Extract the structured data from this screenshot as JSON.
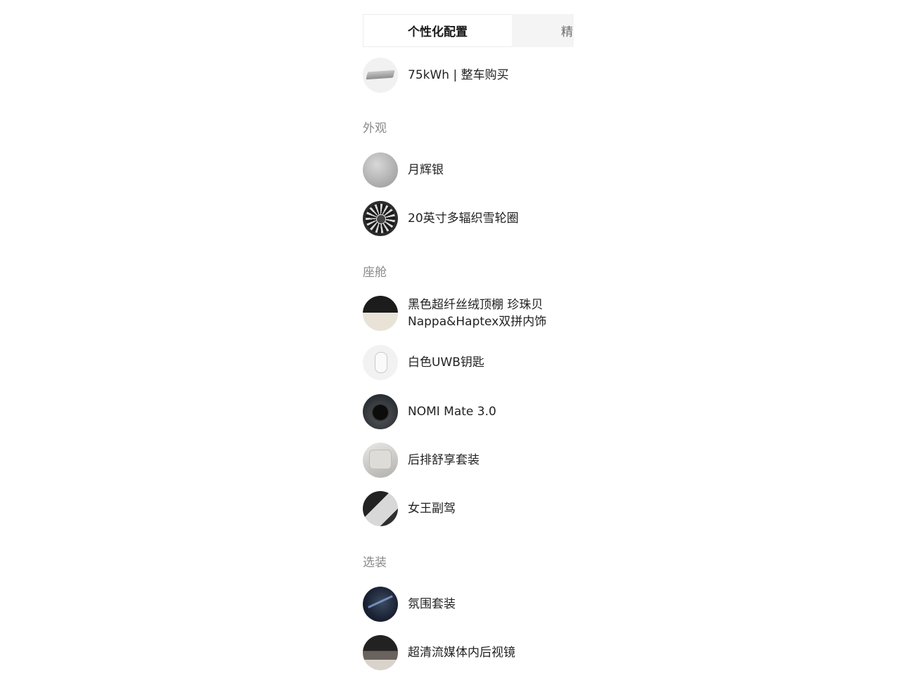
{
  "tabs": [
    {
      "label": "个性化配置",
      "active": true
    },
    {
      "label": "精",
      "active": false
    }
  ],
  "battery": {
    "label": "75kWh | 整车购买",
    "icon": "battery-pack-icon"
  },
  "sections": {
    "exterior": {
      "title": "外观",
      "items": [
        {
          "label": "月辉银",
          "icon": "silver-paint-swatch"
        },
        {
          "label": "20英寸多辐织雪轮圈",
          "icon": "wheel-rim-image"
        }
      ]
    },
    "cabin": {
      "title": "座舱",
      "items": [
        {
          "label_line1": "黑色超纤丝绒顶棚 珍珠贝",
          "label_line2": "Nappa&Haptex双拼内饰",
          "icon": "interior-swatch"
        },
        {
          "label": "白色UWB钥匙",
          "icon": "key-fob-image"
        },
        {
          "label": "NOMI Mate 3.0",
          "icon": "nomi-image"
        },
        {
          "label": "后排舒享套装",
          "icon": "rear-seat-image"
        },
        {
          "label": "女王副驾",
          "icon": "passenger-seat-image"
        }
      ]
    },
    "options": {
      "title": "选装",
      "items": [
        {
          "label": "氛围套装",
          "icon": "ambient-light-image"
        },
        {
          "label": "超清流媒体内后视镜",
          "icon": "rearview-mirror-image"
        }
      ]
    }
  }
}
